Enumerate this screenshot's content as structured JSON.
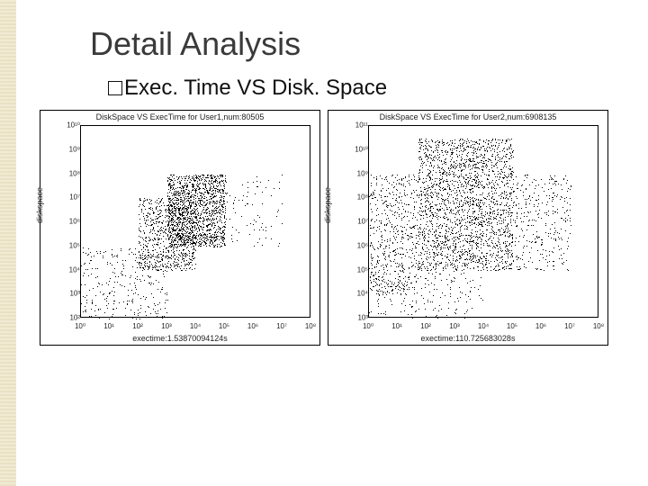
{
  "slide": {
    "title": "Detail Analysis",
    "bullet_text": "Exec. Time  VS  Disk. Space"
  },
  "chart_data": [
    {
      "type": "scatter",
      "title": "DiskSpace VS ExecTime for User1,num:80505",
      "xlabel": "exectime:1.53870094124s",
      "ylabel": "diskspace",
      "x_scale": "log",
      "y_scale": "log",
      "xlim": [
        1,
        100000000.0
      ],
      "ylim": [
        100.0,
        10000000000.0
      ],
      "x_ticks": [
        1,
        10,
        100,
        1000.0,
        10000.0,
        100000.0,
        1000000.0,
        10000000.0,
        100000000.0
      ],
      "y_ticks": [
        100.0,
        1000.0,
        10000.0,
        100000.0,
        1000000.0,
        10000000.0,
        100000000.0,
        1000000000.0,
        10000000000.0
      ],
      "note": "approx 80505 scatter points; region of highest density roughly exectime 1e3–1e5 s, diskspace 1e5–1e8; sparse points down to diskspace~1e2 and exectime~1e0; a few points out to exectime~1e7.",
      "density_boxes": [
        {
          "x0": 1000.0,
          "x1": 100000.0,
          "y0": 100000.0,
          "y1": 100000000.0,
          "d": 0.9
        },
        {
          "x0": 100.0,
          "x1": 10000.0,
          "y0": 10000.0,
          "y1": 10000000.0,
          "d": 0.5
        },
        {
          "x0": 1.0,
          "x1": 1000.0,
          "y0": 100.0,
          "y1": 100000.0,
          "d": 0.12
        },
        {
          "x0": 100000.0,
          "x1": 10000000.0,
          "y0": 100000.0,
          "y1": 100000000.0,
          "d": 0.05
        }
      ]
    },
    {
      "type": "scatter",
      "title": "DiskSpace VS ExecTime for User2,num:6908135",
      "xlabel": "exectime:110.725683028s",
      "ylabel": "diskspace",
      "x_scale": "log",
      "y_scale": "log",
      "xlim": [
        1,
        100000000.0
      ],
      "ylim": [
        1000.0,
        100000000000.0
      ],
      "x_ticks": [
        1,
        10,
        100,
        1000.0,
        10000.0,
        100000.0,
        1000000.0,
        10000000.0,
        100000000.0
      ],
      "y_ticks": [
        1000.0,
        10000.0,
        100000.0,
        1000000.0,
        10000000.0,
        100000000.0,
        1000000000.0,
        10000000000.0,
        100000000000.0
      ],
      "note": "approx 6.9M scatter points; very dense block roughly exectime 1e1–1e5 s, diskspace 1e5–1e10; vertical streaks near exectime≈1e4 and 2e4; sparse tail out to exectime~1e7 at diskspace~1e6–1e8.",
      "density_boxes": [
        {
          "x0": 50.0,
          "x1": 100000.0,
          "y0": 100000.0,
          "y1": 30000000000.0,
          "d": 0.95
        },
        {
          "x0": 1.0,
          "x1": 50.0,
          "y0": 10000.0,
          "y1": 1000000000.0,
          "d": 0.25
        },
        {
          "x0": 100000.0,
          "x1": 10000000.0,
          "y0": 100000.0,
          "y1": 1000000000.0,
          "d": 0.15
        },
        {
          "x0": 1.0,
          "x1": 10000.0,
          "y0": 1000.0,
          "y1": 100000.0,
          "d": 0.08
        }
      ]
    }
  ]
}
